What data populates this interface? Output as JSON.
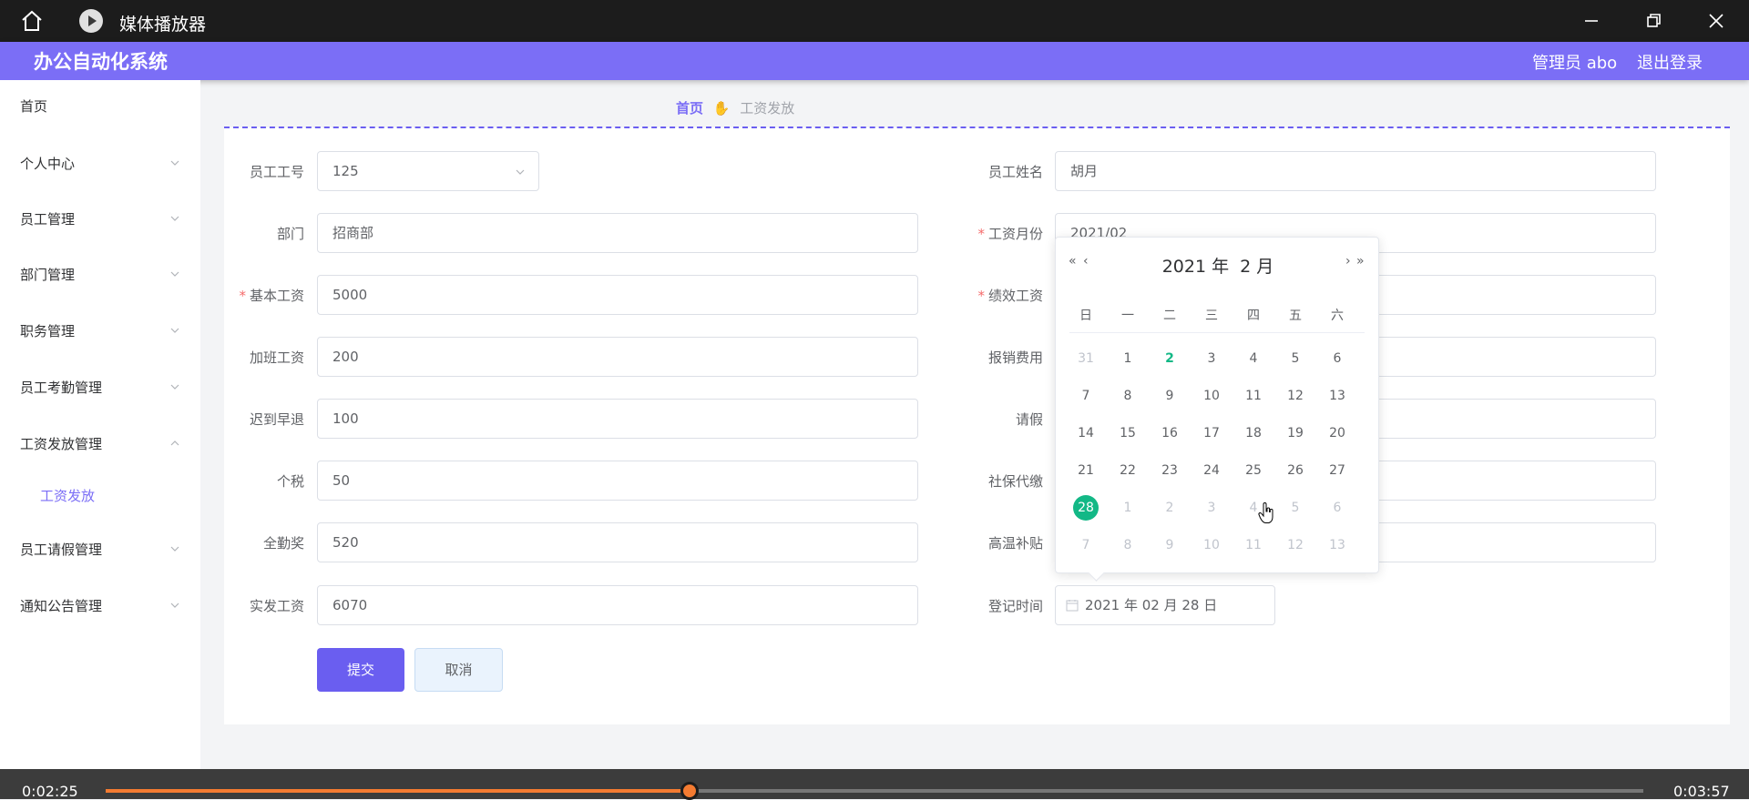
{
  "window": {
    "title": "媒体播放器"
  },
  "header": {
    "brand": "办公自动化系统",
    "user": "管理员 abo",
    "logout": "退出登录"
  },
  "breadcrumb": {
    "home": "首页",
    "current": "工资发放"
  },
  "sidebar": {
    "items": [
      {
        "label": "首页"
      },
      {
        "label": "个人中心"
      },
      {
        "label": "员工管理"
      },
      {
        "label": "部门管理"
      },
      {
        "label": "职务管理"
      },
      {
        "label": "员工考勤管理"
      },
      {
        "label": "工资发放管理"
      },
      {
        "label": "工资发放"
      },
      {
        "label": "员工请假管理"
      },
      {
        "label": "通知公告管理"
      }
    ]
  },
  "form": {
    "emp_id_label": "员工工号",
    "emp_id_value": "125",
    "emp_name_label": "员工姓名",
    "emp_name_value": "胡月",
    "dept_label": "部门",
    "dept_value": "招商部",
    "month_label": "工资月份",
    "month_value": "2021/02",
    "base_label": "基本工资",
    "base_value": "5000",
    "perf_label": "绩效工资",
    "overtime_label": "加班工资",
    "overtime_value": "200",
    "reimburse_label": "报销费用",
    "late_label": "迟到早退",
    "late_value": "100",
    "leave_label": "请假",
    "tax_label": "个税",
    "tax_value": "50",
    "social_label": "社保代缴",
    "attendance_label": "全勤奖",
    "attendance_value": "520",
    "heat_label": "高温补贴",
    "actual_label": "实发工资",
    "actual_value": "6070",
    "reg_label": "登记时间",
    "reg_value": "2021 年 02 月 28 日",
    "submit": "提交",
    "cancel": "取消"
  },
  "calendar": {
    "year": "2021 年",
    "month": "2 月",
    "prev_year": "«",
    "prev_month": "‹",
    "next_month": "›",
    "next_year": "»",
    "weekdays": [
      "日",
      "一",
      "二",
      "三",
      "四",
      "五",
      "六"
    ],
    "weeks": [
      [
        "31",
        "1",
        "2",
        "3",
        "4",
        "5",
        "6"
      ],
      [
        "7",
        "8",
        "9",
        "10",
        "11",
        "12",
        "13"
      ],
      [
        "14",
        "15",
        "16",
        "17",
        "18",
        "19",
        "20"
      ],
      [
        "21",
        "22",
        "23",
        "24",
        "25",
        "26",
        "27"
      ],
      [
        "28",
        "1",
        "2",
        "3",
        "4",
        "5",
        "6"
      ],
      [
        "7",
        "8",
        "9",
        "10",
        "11",
        "12",
        "13"
      ]
    ],
    "today": "2",
    "selected": "28"
  },
  "player": {
    "elapsed": "0:02:25",
    "total": "0:03:57",
    "progress": 0.38
  },
  "colors": {
    "accent": "#7b6ef6",
    "selected": "#13b886",
    "required": "#f56c6c",
    "progress": "#f47b31"
  }
}
